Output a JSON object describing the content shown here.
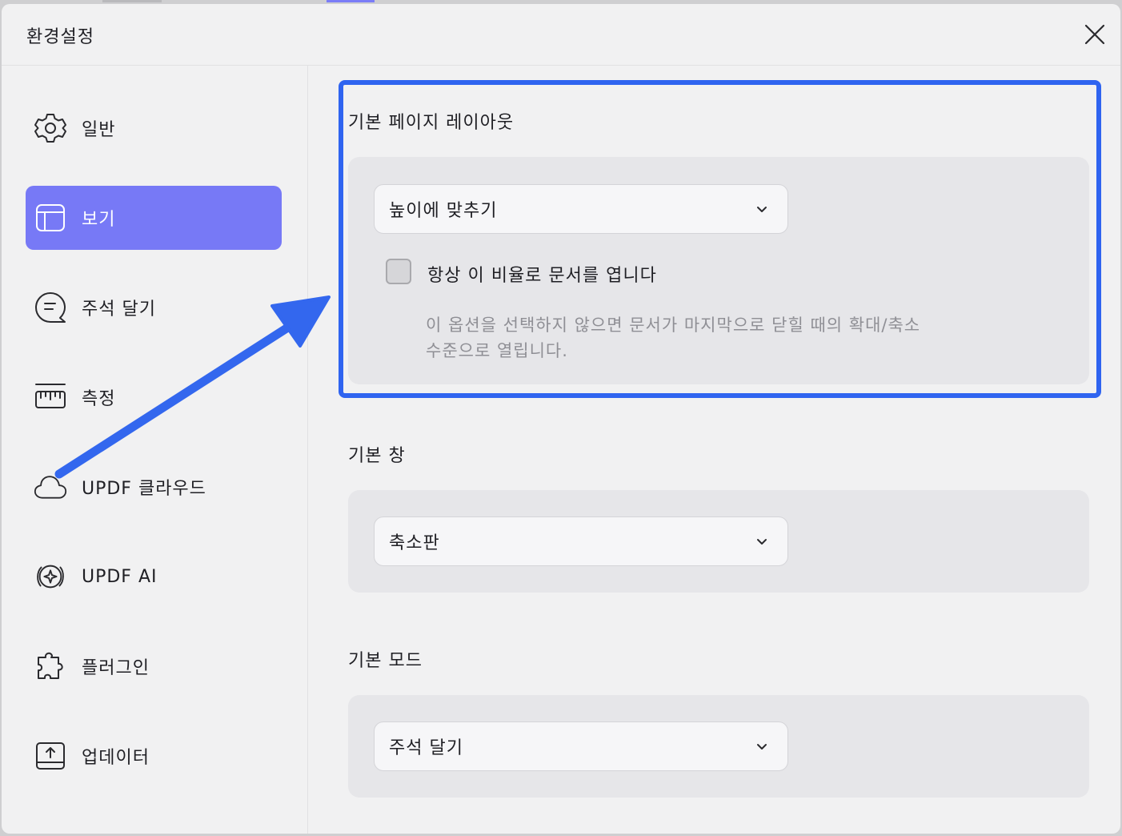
{
  "dialog": {
    "title": "환경설정"
  },
  "sidebar": {
    "items": [
      {
        "label": "일반",
        "icon": "gear-icon"
      },
      {
        "label": "보기",
        "icon": "layout-icon",
        "active": true
      },
      {
        "label": "주석 달기",
        "icon": "comment-icon"
      },
      {
        "label": "측정",
        "icon": "ruler-icon"
      },
      {
        "label": "UPDF 클라우드",
        "icon": "cloud-icon"
      },
      {
        "label": "UPDF AI",
        "icon": "ai-sparkle-icon"
      },
      {
        "label": "플러그인",
        "icon": "puzzle-icon"
      },
      {
        "label": "업데이터",
        "icon": "update-icon"
      }
    ]
  },
  "main": {
    "page_layout": {
      "title": "기본 페이지 레이아웃",
      "selected": "높이에 맞추기",
      "checkbox_label": "항상 이 비율로 문서를 엽니다",
      "checkbox_checked": false,
      "hint_line1": "이 옵션을 선택하지 않으면 문서가 마지막으로 닫힐 때의 확대/축소",
      "hint_line2": "수준으로 열립니다."
    },
    "default_window": {
      "title": "기본 창",
      "selected": "축소판"
    },
    "default_mode": {
      "title": "기본 모드",
      "selected": "주석 달기"
    }
  },
  "colors": {
    "accent": "#7779f6",
    "highlight": "#2f64f0",
    "annotation_arrow": "#3367ee",
    "dialog_bg": "#f1f1f2",
    "card_bg": "#e6e6e9"
  }
}
